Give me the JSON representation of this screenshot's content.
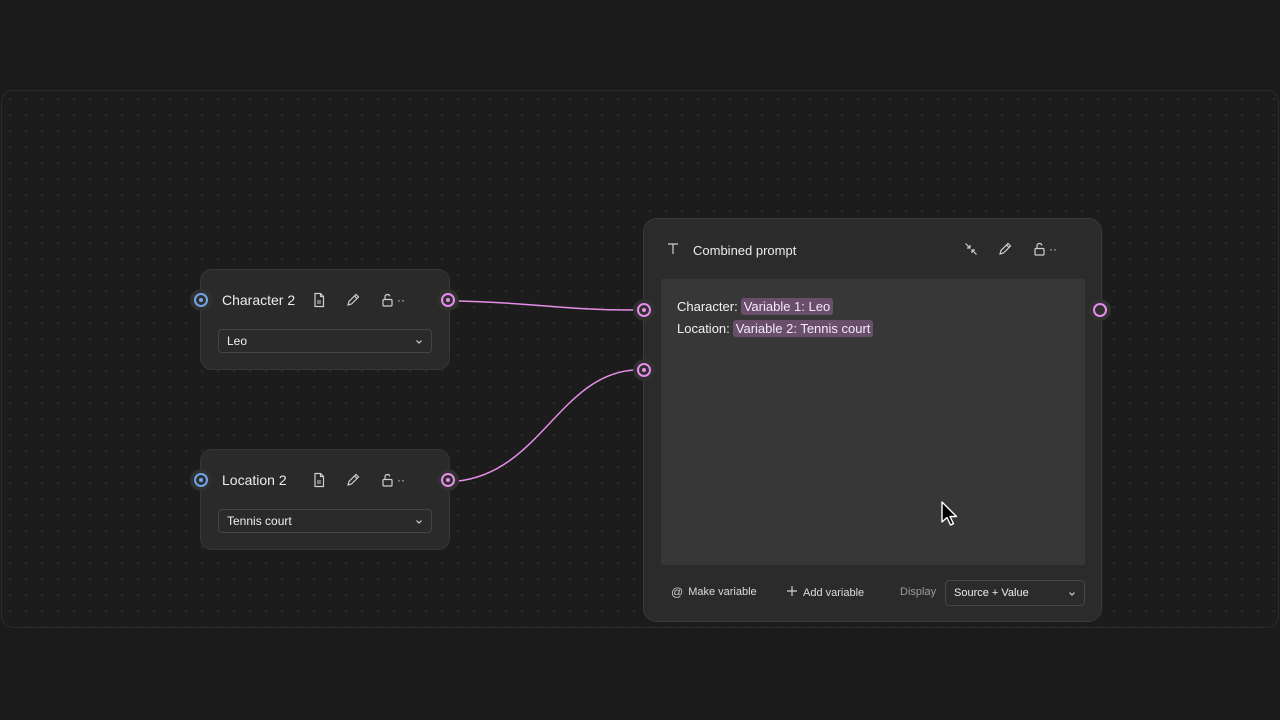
{
  "nodes": {
    "character": {
      "title": "Character 2",
      "value": "Leo"
    },
    "location": {
      "title": "Location 2",
      "value": "Tennis court"
    },
    "combined": {
      "title": "Combined prompt",
      "lines": [
        {
          "label": "Character:",
          "chip": "Variable 1: Leo"
        },
        {
          "label": "Location:",
          "chip": "Variable 2: Tennis court"
        }
      ],
      "footer": {
        "make_variable": "Make variable",
        "add_variable": "Add variable",
        "display_label": "Display",
        "display_value": "Source + Value"
      }
    }
  },
  "colors": {
    "wire": "#e58de8",
    "input_port": "#6ea6e8",
    "output_port": "#e58de8",
    "chip_bg": "#6a4f6d"
  },
  "icons": {
    "file": "file-icon",
    "edit": "pencil-icon",
    "lock": "unlock-icon",
    "more": "more-icon",
    "text": "text-icon",
    "collapse": "collapse-icon",
    "at": "at-icon",
    "plus": "plus-icon"
  }
}
